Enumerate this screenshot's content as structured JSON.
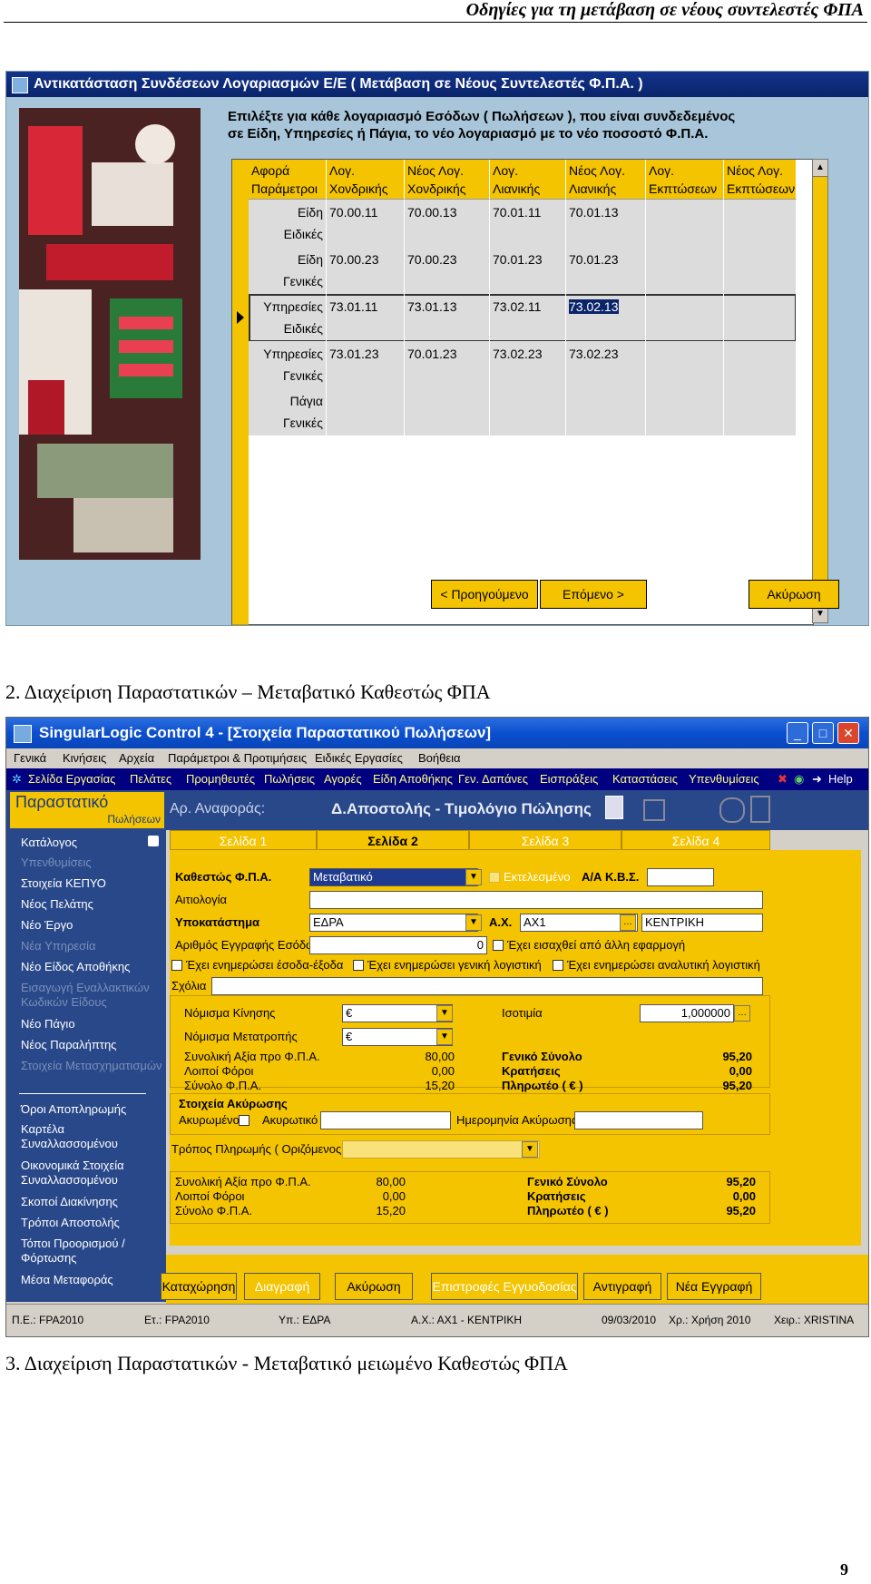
{
  "header": {
    "title": "Οδηγίες για τη μετάβαση σε νέους συντελεστές ΦΠΑ"
  },
  "screen1": {
    "window_title": "Αντικατάσταση Συνδέσεων Λογαριασμών Ε/Ε ( Μετάβαση σε Νέους Συντελεστές Φ.Π.Α. )",
    "instructions_line1": "Επιλέξτε για κάθε λογαριασμό Εσόδων ( Πωλήσεων ), που είναι συνδεδεμένος",
    "instructions_line2": "σε Είδη, Υπηρεσίες ή Πάγια, το νέο λογαριασμό με το νέο ποσοστό Φ.Π.Α.",
    "columns": [
      {
        "l1": "Αφορά",
        "l2": "Παράμετροι"
      },
      {
        "l1": "Λογ.",
        "l2": "Χονδρικής"
      },
      {
        "l1": "Νέος Λογ.",
        "l2": "Χονδρικής"
      },
      {
        "l1": "Λογ.",
        "l2": "Λιανικής"
      },
      {
        "l1": "Νέος Λογ.",
        "l2": "Λιανικής"
      },
      {
        "l1": "Λογ.",
        "l2": "Εκπτώσεων"
      },
      {
        "l1": "Νέος Λογ.",
        "l2": "Εκπτώσεων"
      }
    ],
    "rows": [
      {
        "a1": "Είδη",
        "a2": "Ειδικές",
        "c1": "70.00.11",
        "c2": "70.00.13",
        "c3": "70.01.11",
        "c4": "70.01.13"
      },
      {
        "a1": "Είδη",
        "a2": "Γενικές",
        "c1": "70.00.23",
        "c2": "70.00.23",
        "c3": "70.01.23",
        "c4": "70.01.23"
      },
      {
        "a1": "Υπηρεσίες",
        "a2": "Ειδικές",
        "c1": "73.01.11",
        "c2": "73.01.13",
        "c3": "73.02.11",
        "c4": "73.02.13"
      },
      {
        "a1": "Υπηρεσίες",
        "a2": "Γενικές",
        "c1": "73.01.23",
        "c2": "70.01.23",
        "c3": "73.02.23",
        "c4": "73.02.23"
      },
      {
        "a1": "Πάγια",
        "a2": "Γενικές",
        "c1": "",
        "c2": "",
        "c3": "",
        "c4": ""
      }
    ],
    "btn_prev": "< Προηγούμενο",
    "btn_next": "Επόμενο >",
    "btn_cancel": "Ακύρωση"
  },
  "section2": {
    "heading": "2.   Διαχείριση Παραστατικών – Μεταβατικό Καθεστώς ΦΠΑ"
  },
  "screen2": {
    "window_title": "SingularLogic Control 4 - [Στοιχεία Παραστατικού Πωλήσεων]",
    "menu": [
      "Γενικά",
      "Κινήσεις",
      "Αρχεία",
      "Παράμετροι & Προτιμήσεις",
      "Ειδικές Εργασίες",
      "Βοήθεια"
    ],
    "toolbar": [
      "Σελίδα Εργασίας",
      "Πελάτες",
      "Προμηθευτές",
      "Πωλήσεις",
      "Αγορές",
      "Είδη Αποθήκης",
      "Γεν. Δαπάνες",
      "Εισπράξεις",
      "Καταστάσεις",
      "Υπενθυμίσεις",
      "Help"
    ],
    "side_title": "Παραστατικό",
    "side_subtitle": "Πωλήσεων",
    "side_items": [
      {
        "label": "Κατάλογος",
        "disabled": false
      },
      {
        "label": "Υπενθυμίσεις",
        "disabled": true
      },
      {
        "label": "Στοιχεία ΚΕΠΥΟ",
        "disabled": false
      },
      {
        "label": "Νέος Πελάτης",
        "disabled": false
      },
      {
        "label": "Νέο Έργο",
        "disabled": false
      },
      {
        "label": "Νέα Υπηρεσία",
        "disabled": true
      },
      {
        "label": "Νέο Είδος Αποθήκης",
        "disabled": false
      },
      {
        "label": "Εισαγωγή Εναλλακτικών Κωδικών Είδους",
        "disabled": true
      },
      {
        "label": "Νέο Πάγιο",
        "disabled": false
      },
      {
        "label": "Νέος Παραλήπτης",
        "disabled": false
      },
      {
        "label": "Στοιχεία Μετασχηματισμών",
        "disabled": true
      },
      {
        "label": "Όροι Αποπληρωμής",
        "disabled": false
      },
      {
        "label": "Καρτέλα Συναλλασσομένου",
        "disabled": false
      },
      {
        "label": "Οικονομικά Στοιχεία Συναλλασσομένου",
        "disabled": false
      },
      {
        "label": "Σκοποί Διακίνησης",
        "disabled": false
      },
      {
        "label": "Τρόποι Αποστολής",
        "disabled": false
      },
      {
        "label": "Τόποι Προορισμού / Φόρτωσης",
        "disabled": false
      },
      {
        "label": "Μέσα Μεταφοράς",
        "disabled": false
      }
    ],
    "ref_label": "Αρ. Αναφοράς:",
    "doc_title": "Δ.Αποστολής - Τιμολόγιο Πώλησης",
    "tabs": [
      "Σελίδα 1",
      "Σελίδα 2",
      "Σελίδα 3",
      "Σελίδα 4"
    ],
    "vat_status_label": "Καθεστώς Φ.Π.Α.",
    "vat_status_value": "Μεταβατικό",
    "executed_label": "Εκτελεσμένο",
    "kbs_label": "Α/Α Κ.Β.Σ.",
    "reason_label": "Αιτιολογία",
    "branch_label": "Υποκατάστημα",
    "branch_value": "ΕΔΡΑ",
    "wh_label": "Α.Χ.",
    "wh_value": "ΑΧ1",
    "wh_name": "ΚΕΝΤΡΙΚΗ ΑΠΟΘΗΚΗ",
    "income_reg_label": "Αριθμός Εγγραφής Εσόδων",
    "income_reg_value": "0",
    "imported_label": "Έχει εισαχθεί από άλλη εφαρμογή",
    "upd1": "Έχει ενημερώσει έσοδα-έξοδα",
    "upd2": "Έχει ενημερώσει γενική λογιστική",
    "upd3": "Έχει ενημερώσει αναλυτική λογιστική",
    "comments_label": "Σχόλια",
    "currency_label": "Νόμισμα Κίνησης",
    "currency_value": "€",
    "conv_label": "Νόμισμα Μετατροπής",
    "conv_value": "€",
    "parity_label": "Ισοτιμία",
    "parity_value": "1,000000",
    "totals1": [
      {
        "label": "Συνολική Αξία προ Φ.Π.Α.",
        "value": "80,00"
      },
      {
        "label": "Λοιποί Φόροι",
        "value": "0,00"
      },
      {
        "label": "Σύνολο Φ.Π.Α.",
        "value": "15,20"
      }
    ],
    "totals1r": [
      {
        "label": "Γενικό Σύνολο",
        "value": "95,20"
      },
      {
        "label": "Κρατήσεις",
        "value": "0,00"
      },
      {
        "label": "Πληρωτέο ( €         )",
        "value": "95,20"
      }
    ],
    "cancel_title": "Στοιχεία Ακύρωσης",
    "cancelled_label": "Ακυρωμένο",
    "cancelling_label": "Ακυρωτικό",
    "cancel_date_label": "Ημερομηνία Ακύρωσης",
    "payment_label": "Τρόπος Πληρωμής ( Οριζόμενος )",
    "totals2": [
      {
        "label": "Συνολική Αξία προ Φ.Π.Α.",
        "value": "80,00"
      },
      {
        "label": "Λοιποί Φόροι",
        "value": "0,00"
      },
      {
        "label": "Σύνολο Φ.Π.Α.",
        "value": "15,20"
      }
    ],
    "totals2r": [
      {
        "label": "Γενικό Σύνολο",
        "value": "95,20"
      },
      {
        "label": "Κρατήσεις",
        "value": "0,00"
      },
      {
        "label": "Πληρωτέο ( €         )",
        "value": "95,20"
      }
    ],
    "buttons": [
      "Καταχώρηση",
      "Διαγραφή",
      "Ακύρωση",
      "Επιστροφές Εγγυοδοσίας",
      "Αντιγραφή",
      "Νέα Εγγραφή"
    ],
    "status": [
      "Π.Ε.: FPA2010",
      "Ετ.: FPA2010",
      "Υπ.: ΕΔΡΑ",
      "Α.Χ.: ΑΧ1 - ΚΕΝΤΡΙΚΗ",
      "09/03/2010",
      "Χρ.: Χρήση 2010",
      "Χειρ.: XRISTINA"
    ]
  },
  "section3": {
    "heading": "3.   Διαχείριση Παραστατικών  - Μεταβατικό μειωμένο Καθεστώς ΦΠΑ"
  },
  "page_number": "9",
  "colors": {
    "accent_yellow": "#f5c400",
    "sidebar_blue": "#29488a",
    "title_blue": "#0a246a"
  }
}
